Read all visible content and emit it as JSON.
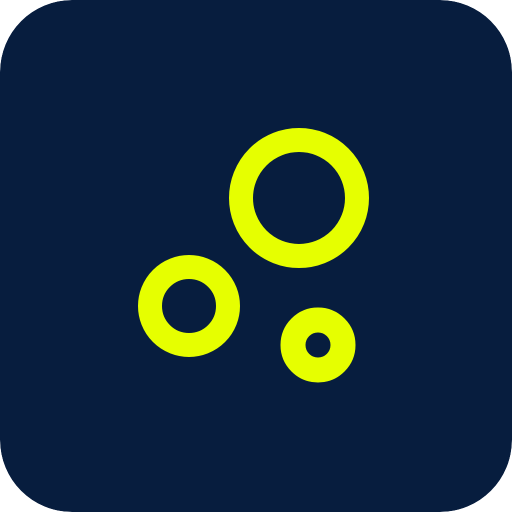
{
  "app_icon": {
    "name": "bubbles-icon",
    "background_color": "#071D3E",
    "accent_color": "#E6FF00"
  }
}
